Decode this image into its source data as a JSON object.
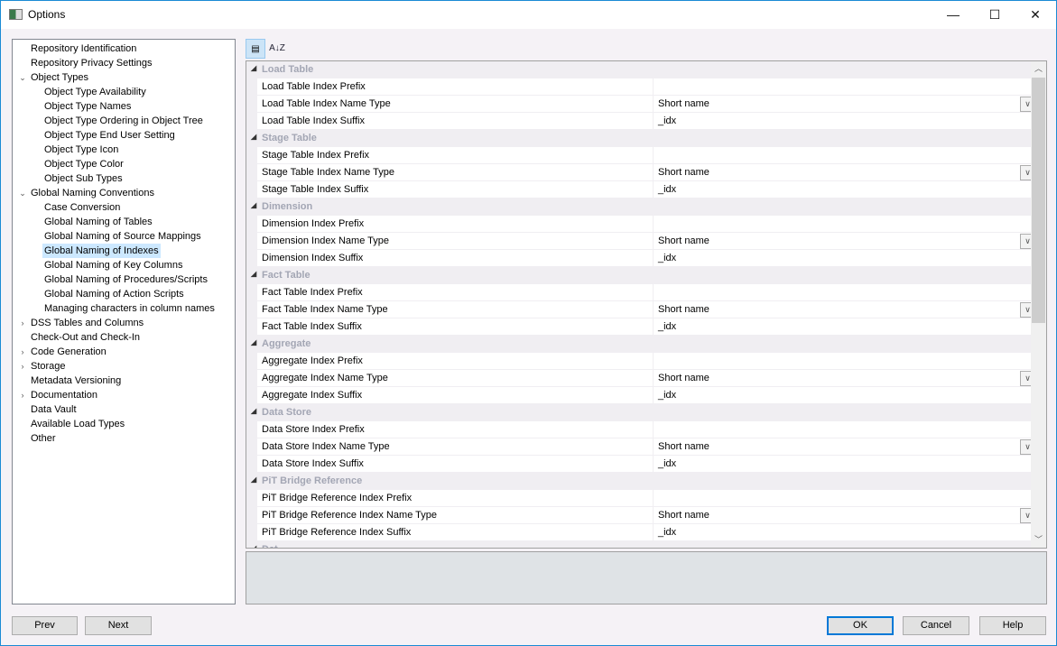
{
  "window": {
    "title": "Options",
    "minimize": "—",
    "maximize": "☐",
    "close": "✕"
  },
  "toolbar": {
    "categorized": "▤",
    "alphabetical": "A↓Z"
  },
  "tree": [
    {
      "label": "Repository Identification",
      "level": 0,
      "exp": ""
    },
    {
      "label": "Repository Privacy Settings",
      "level": 0,
      "exp": ""
    },
    {
      "label": "Object Types",
      "level": 0,
      "exp": "⌄"
    },
    {
      "label": "Object Type Availability",
      "level": 1,
      "exp": ""
    },
    {
      "label": "Object Type Names",
      "level": 1,
      "exp": ""
    },
    {
      "label": "Object Type Ordering in Object Tree",
      "level": 1,
      "exp": ""
    },
    {
      "label": "Object Type End User Setting",
      "level": 1,
      "exp": ""
    },
    {
      "label": "Object Type Icon",
      "level": 1,
      "exp": ""
    },
    {
      "label": "Object Type Color",
      "level": 1,
      "exp": ""
    },
    {
      "label": "Object Sub Types",
      "level": 1,
      "exp": ""
    },
    {
      "label": "Global Naming Conventions",
      "level": 0,
      "exp": "⌄"
    },
    {
      "label": "Case Conversion",
      "level": 1,
      "exp": ""
    },
    {
      "label": "Global Naming of Tables",
      "level": 1,
      "exp": ""
    },
    {
      "label": "Global Naming of Source Mappings",
      "level": 1,
      "exp": ""
    },
    {
      "label": "Global Naming of Indexes",
      "level": 1,
      "exp": "",
      "selected": true
    },
    {
      "label": "Global Naming of Key Columns",
      "level": 1,
      "exp": ""
    },
    {
      "label": "Global Naming of Procedures/Scripts",
      "level": 1,
      "exp": ""
    },
    {
      "label": "Global Naming of Action Scripts",
      "level": 1,
      "exp": ""
    },
    {
      "label": "Managing characters in column names",
      "level": 1,
      "exp": ""
    },
    {
      "label": "DSS Tables and Columns",
      "level": 0,
      "exp": "›"
    },
    {
      "label": "Check-Out and Check-In",
      "level": 0,
      "exp": ""
    },
    {
      "label": "Code Generation",
      "level": 0,
      "exp": "›"
    },
    {
      "label": "Storage",
      "level": 0,
      "exp": "›"
    },
    {
      "label": "Metadata Versioning",
      "level": 0,
      "exp": ""
    },
    {
      "label": "Documentation",
      "level": 0,
      "exp": "›"
    },
    {
      "label": "Data Vault",
      "level": 0,
      "exp": ""
    },
    {
      "label": "Available Load Types",
      "level": 0,
      "exp": ""
    },
    {
      "label": "Other",
      "level": 0,
      "exp": ""
    }
  ],
  "grid": [
    {
      "category": "Load Table",
      "props": [
        {
          "name": "Load Table Index Prefix",
          "value": ""
        },
        {
          "name": "Load Table Index Name Type",
          "value": "Short name",
          "dropdown": true
        },
        {
          "name": "Load Table Index Suffix",
          "value": "_idx"
        }
      ]
    },
    {
      "category": "Stage Table",
      "props": [
        {
          "name": "Stage Table Index Prefix",
          "value": ""
        },
        {
          "name": "Stage Table Index Name Type",
          "value": "Short name",
          "dropdown": true
        },
        {
          "name": "Stage Table Index Suffix",
          "value": "_idx"
        }
      ]
    },
    {
      "category": "Dimension",
      "props": [
        {
          "name": "Dimension Index Prefix",
          "value": ""
        },
        {
          "name": "Dimension Index Name Type",
          "value": "Short name",
          "dropdown": true
        },
        {
          "name": "Dimension Index Suffix",
          "value": "_idx"
        }
      ]
    },
    {
      "category": "Fact Table",
      "props": [
        {
          "name": "Fact Table Index Prefix",
          "value": ""
        },
        {
          "name": "Fact Table Index Name Type",
          "value": "Short name",
          "dropdown": true
        },
        {
          "name": "Fact Table Index Suffix",
          "value": "_idx"
        }
      ]
    },
    {
      "category": "Aggregate",
      "props": [
        {
          "name": "Aggregate Index Prefix",
          "value": ""
        },
        {
          "name": "Aggregate Index Name Type",
          "value": "Short name",
          "dropdown": true
        },
        {
          "name": "Aggregate Index Suffix",
          "value": "_idx"
        }
      ]
    },
    {
      "category": "Data Store",
      "props": [
        {
          "name": "Data Store Index Prefix",
          "value": ""
        },
        {
          "name": "Data Store Index Name Type",
          "value": "Short name",
          "dropdown": true
        },
        {
          "name": "Data Store Index Suffix",
          "value": "_idx"
        }
      ]
    },
    {
      "category": "PiT Bridge Reference",
      "props": [
        {
          "name": "PiT Bridge Reference Index Prefix",
          "value": ""
        },
        {
          "name": "PiT Bridge Reference Index Name Type",
          "value": "Short name",
          "dropdown": true
        },
        {
          "name": "PiT Bridge Reference Index Suffix",
          "value": "_idx"
        }
      ]
    },
    {
      "category": "Dat",
      "props": []
    }
  ],
  "buttons": {
    "prev": "Prev",
    "next": "Next",
    "ok": "OK",
    "cancel": "Cancel",
    "help": "Help"
  }
}
